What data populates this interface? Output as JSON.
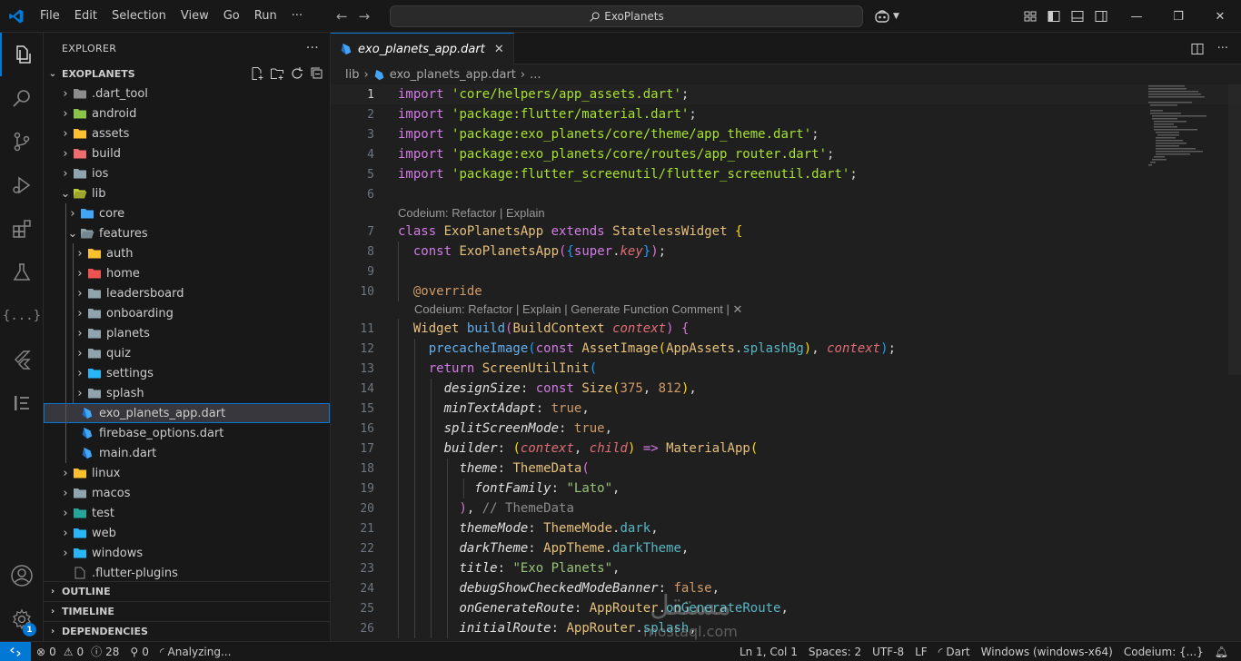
{
  "titlebar": {
    "menu": [
      "File",
      "Edit",
      "Selection",
      "View",
      "Go",
      "Run",
      "···"
    ],
    "search_text": "ExoPlanets"
  },
  "sidebar": {
    "header": "EXPLORER",
    "more": "···",
    "project": "EXOPLANETS",
    "tree": [
      {
        "label": ".dart_tool",
        "type": "folder",
        "depth": 0,
        "open": false,
        "icon_color": "#8c8c8c"
      },
      {
        "label": "android",
        "type": "folder",
        "depth": 0,
        "open": false,
        "icon_color": "#8bc34a"
      },
      {
        "label": "assets",
        "type": "folder",
        "depth": 0,
        "open": false,
        "icon_color": "#fbc02d"
      },
      {
        "label": "build",
        "type": "folder",
        "depth": 0,
        "open": false,
        "icon_color": "#ef6c6c"
      },
      {
        "label": "ios",
        "type": "folder",
        "depth": 0,
        "open": false,
        "icon_color": "#90a4ae"
      },
      {
        "label": "lib",
        "type": "folder",
        "depth": 0,
        "open": true,
        "icon_color": "#c0ca33"
      },
      {
        "label": "core",
        "type": "folder",
        "depth": 1,
        "open": false,
        "icon_color": "#42a5f5"
      },
      {
        "label": "features",
        "type": "folder",
        "depth": 1,
        "open": true,
        "icon_color": "#90a4ae"
      },
      {
        "label": "auth",
        "type": "folder",
        "depth": 2,
        "open": false,
        "icon_color": "#fbc02d"
      },
      {
        "label": "home",
        "type": "folder",
        "depth": 2,
        "open": false,
        "icon_color": "#ef5350"
      },
      {
        "label": "leadersboard",
        "type": "folder",
        "depth": 2,
        "open": false,
        "icon_color": "#90a4ae"
      },
      {
        "label": "onboarding",
        "type": "folder",
        "depth": 2,
        "open": false,
        "icon_color": "#90a4ae"
      },
      {
        "label": "planets",
        "type": "folder",
        "depth": 2,
        "open": false,
        "icon_color": "#90a4ae"
      },
      {
        "label": "quiz",
        "type": "folder",
        "depth": 2,
        "open": false,
        "icon_color": "#90a4ae"
      },
      {
        "label": "settings",
        "type": "folder",
        "depth": 2,
        "open": false,
        "icon_color": "#29b6f6"
      },
      {
        "label": "splash",
        "type": "folder",
        "depth": 2,
        "open": false,
        "icon_color": "#90a4ae"
      },
      {
        "label": "exo_planets_app.dart",
        "type": "dart",
        "depth": 1,
        "selected": true
      },
      {
        "label": "firebase_options.dart",
        "type": "dart",
        "depth": 1
      },
      {
        "label": "main.dart",
        "type": "dart",
        "depth": 1
      },
      {
        "label": "linux",
        "type": "folder",
        "depth": 0,
        "open": false,
        "icon_color": "#fbc02d"
      },
      {
        "label": "macos",
        "type": "folder",
        "depth": 0,
        "open": false,
        "icon_color": "#90a4ae"
      },
      {
        "label": "test",
        "type": "folder",
        "depth": 0,
        "open": false,
        "icon_color": "#26a69a"
      },
      {
        "label": "web",
        "type": "folder",
        "depth": 0,
        "open": false,
        "icon_color": "#29b6f6"
      },
      {
        "label": "windows",
        "type": "folder",
        "depth": 0,
        "open": false,
        "icon_color": "#29b6f6"
      },
      {
        "label": ".flutter-plugins",
        "type": "file",
        "depth": 0
      }
    ],
    "sections": [
      "OUTLINE",
      "TIMELINE",
      "DEPENDENCIES"
    ]
  },
  "editor": {
    "tab_label": "exo_planets_app.dart",
    "breadcrumb": [
      "lib",
      "exo_planets_app.dart",
      "..."
    ],
    "codelens_1": "Codeium: Refactor | Explain",
    "codelens_2": "Codeium: Refactor | Explain | Generate Function Comment | ✕",
    "line_numbers": [
      "1",
      "2",
      "3",
      "4",
      "5",
      "6",
      "7",
      "8",
      "9",
      "10",
      "11",
      "12",
      "13",
      "14",
      "15",
      "16",
      "17",
      "18",
      "19",
      "20",
      "21",
      "22",
      "23",
      "24",
      "25",
      "26"
    ]
  },
  "statusbar": {
    "errors": "0",
    "warnings": "0",
    "infos": "28",
    "ports": "0",
    "analyzing": "Analyzing...",
    "position": "Ln 1, Col 1",
    "spaces": "Spaces: 2",
    "encoding": "UTF-8",
    "eol": "LF",
    "language": "Dart",
    "device": "Windows (windows-x64)",
    "codeium": "Codeium: {...}"
  },
  "activity_badge": "1",
  "icons": [
    "vscode-logo-icon",
    "explorer-icon",
    "search-icon",
    "source-control-icon",
    "run-debug-icon",
    "extensions-icon",
    "testing-icon",
    "json-icon",
    "flutter-icon",
    "list-icon",
    "account-icon",
    "settings-gear-icon"
  ],
  "watermark": "mostaql.com"
}
